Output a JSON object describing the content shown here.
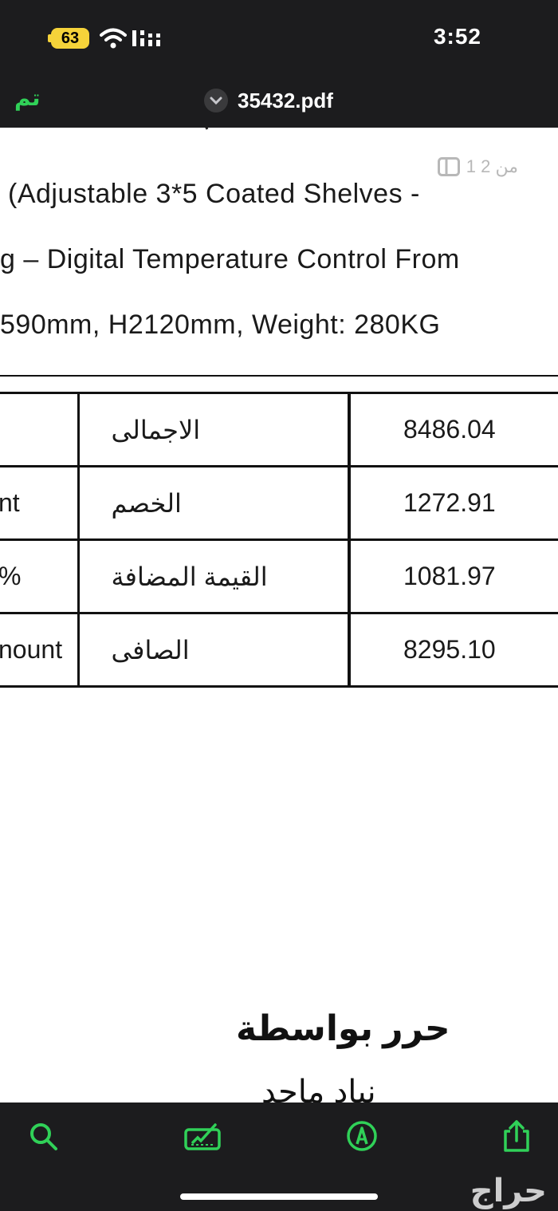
{
  "status_bar": {
    "battery": "63",
    "time": "3:52"
  },
  "nav": {
    "done_label": "تم",
    "title": "35432.pdf"
  },
  "document": {
    "page_indicator": "1 من 2",
    "description_lines": [
      "(Adjustable 3*5 Coated Shelves -",
      "g – Digital Temperature Control From",
      "590mm, H2120mm, Weight: 280KG"
    ],
    "totals": [
      {
        "en": "",
        "ar": "الاجمالى",
        "value": "8486.04"
      },
      {
        "en": "nt",
        "ar": "الخصم",
        "value": "1272.91"
      },
      {
        "en": "%",
        "ar": "القيمة المضافة",
        "value": "1081.97"
      },
      {
        "en": "nount",
        "ar": "الصافى",
        "value": "8295.10"
      }
    ],
    "signed_by_label": "حرر بواسطة",
    "signer_name": "نياد ماجد"
  },
  "toolbar": {
    "icons": [
      "search-icon",
      "markup-icon",
      "annotate-icon",
      "share-icon"
    ],
    "accent": "#30d158"
  },
  "watermark": "حراج"
}
